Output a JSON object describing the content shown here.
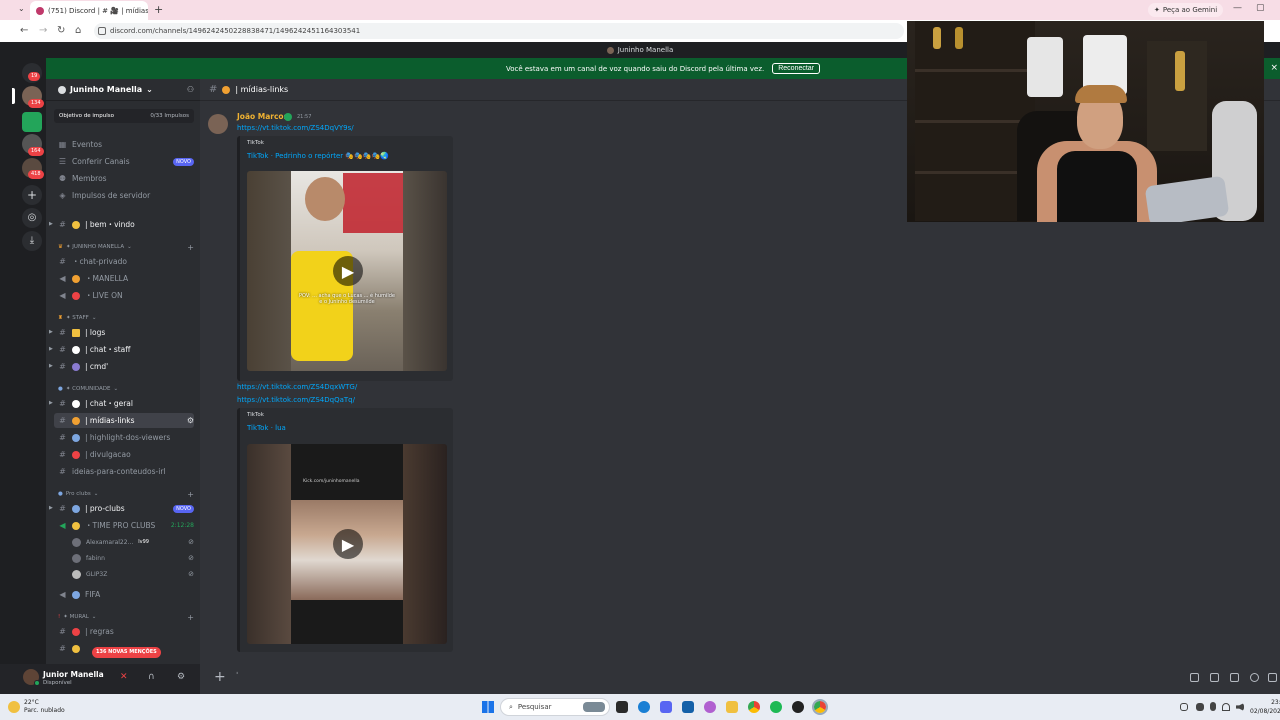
{
  "browser": {
    "tab_title": "(751) Discord | # 🎥 | mídias-lin...",
    "tab_close": "×",
    "new_tab": "+",
    "gemini_label": "Peça ao Gemini",
    "url": "discord.com/channels/1496242450228838471/1496242451164303541"
  },
  "discord": {
    "window_title": "Juninho Manella",
    "banner_text": "Você estava em um canal de voz quando saiu do Discord pela última vez.",
    "reconnect_label": "Reconectar",
    "rail_badges": [
      "19",
      "134",
      "164",
      "418"
    ],
    "guild_name": "Juninho Manella",
    "boost": {
      "label": "Objetivo de impulso",
      "value": "0/33 Impulsos"
    },
    "menu": [
      {
        "icon": "calendar-icon",
        "label": "Eventos"
      },
      {
        "icon": "browse-icon",
        "label": "Conferir Canais",
        "badge": "NOVO"
      },
      {
        "icon": "members-icon",
        "label": "Membros"
      },
      {
        "icon": "boost-icon",
        "label": "Impulsos de servidor"
      }
    ],
    "channels": {
      "bem_vindo": "| bem・vindo",
      "cat_juninho": "✦ JUNINHO MANELLA",
      "chat_privado": "・chat-privado",
      "manella": "・MANELLA",
      "live_on": "・LIVE ON",
      "cat_staff": "✦ STAFF",
      "logs": "| logs",
      "chat_staff": "| chat・staff",
      "cmd": "| cmd'",
      "cat_comunidade": "✦ COMUNIDADE",
      "chat_geral": "| chat・geral",
      "midias_links": "| mídias-links",
      "highlight": "| highlight-dos-viewers",
      "divulgacao": "| divulgacao",
      "ideias": "ideias-para-conteudos-irl",
      "cat_proclubs": "Pro clubs",
      "pro_clubs": "| pro-clubs",
      "pro_clubs_badge": "NOVO",
      "time_pro_clubs": "・TIME PRO CLUBS",
      "time_pro_clubs_timer": "2:12:28",
      "voice_users": [
        "Alexamaral22...",
        "fabinn",
        "GLIP3Z"
      ],
      "voice_user_tag": "lv99",
      "fifa": "FIFA",
      "cat_mural": "✦ MURAL",
      "regras": "| regras"
    },
    "mentions_pill": "136 NOVAS MENÇÕES",
    "user": {
      "name": "Junior Manella",
      "status": "Disponível"
    },
    "channel_header": "| mídias-links",
    "message": {
      "author": "João Marcos",
      "time": "21:57",
      "links": [
        "https://vt.tiktok.com/ZS4DqVY9s/",
        "https://vt.tiktok.com/ZS4DqxWTG/",
        "https://vt.tiktok.com/ZS4DqQaTq/"
      ],
      "embeds": [
        {
          "provider": "TikTok",
          "title": "TikTok · Pedrinho o repórter 🎭🎭🎭🎭🌏",
          "caption": "POV: ... acha que o Lucas ... é humilde e o Juninho desumilde"
        },
        {
          "provider": "TikTok",
          "title": "TikTok · lua",
          "caption": "Kick.com/juninhomanella"
        }
      ]
    }
  },
  "taskbar": {
    "weather_temp": "22°C",
    "weather_desc": "Parc. nublado",
    "search_placeholder": "Pesquisar",
    "time": "23:",
    "date": "02/08/202"
  }
}
